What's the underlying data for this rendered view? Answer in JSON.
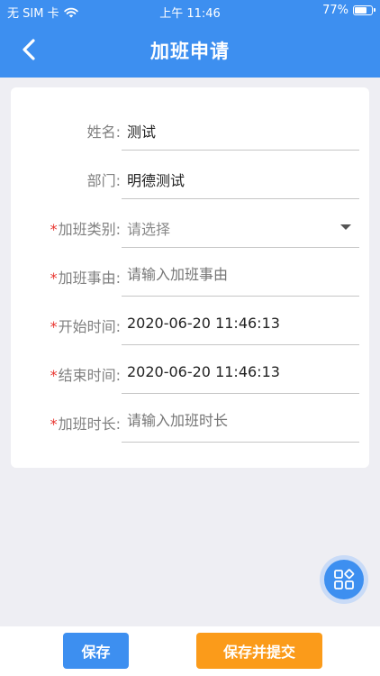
{
  "status_bar": {
    "carrier": "无 SIM 卡",
    "time": "上午 11:46",
    "battery_percent": "77%",
    "battery_level": 0.77
  },
  "nav": {
    "title": "加班申请"
  },
  "form": {
    "name": {
      "label": "姓名:",
      "value": "测试",
      "required": false
    },
    "department": {
      "label": "部门:",
      "value": "明德测试",
      "required": false
    },
    "category": {
      "label": "加班类别:",
      "placeholder": "请选择",
      "required": true
    },
    "reason": {
      "label": "加班事由:",
      "placeholder": "请输入加班事由",
      "required": true
    },
    "start_time": {
      "label": "开始时间:",
      "value": "2020-06-20 11:46:13",
      "required": true
    },
    "end_time": {
      "label": "结束时间:",
      "value": "2020-06-20 11:46:13",
      "required": true
    },
    "duration": {
      "label": "加班时长:",
      "placeholder": "请输入加班时长",
      "required": true
    },
    "required_mark": "*"
  },
  "actions": {
    "save_label": "保存",
    "submit_label": "保存并提交"
  },
  "colors": {
    "primary": "#3d8ff0",
    "accent": "#fb9b1a",
    "required": "#e8342e"
  }
}
